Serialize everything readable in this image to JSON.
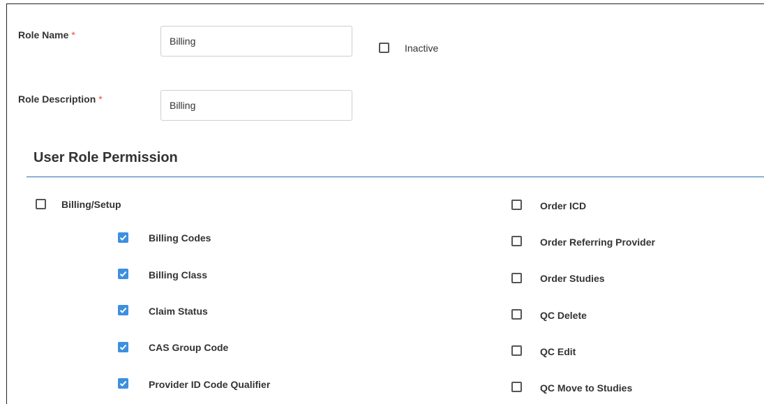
{
  "form": {
    "role_name_label": "Role Name",
    "role_name_value": "Billing",
    "role_description_label": "Role Description",
    "role_description_value": "Billing",
    "required_marker": "*",
    "inactive_label": "Inactive",
    "inactive_checked": false
  },
  "permissions": {
    "title": "User Role Permission",
    "group": {
      "label": "Billing/Setup",
      "checked": false,
      "children": [
        {
          "label": "Billing Codes",
          "checked": true
        },
        {
          "label": "Billing Class",
          "checked": true
        },
        {
          "label": "Claim Status",
          "checked": true
        },
        {
          "label": "CAS Group Code",
          "checked": true
        },
        {
          "label": "Provider ID Code Qualifier",
          "checked": true
        }
      ]
    },
    "right_column": [
      {
        "label": "Order ICD",
        "checked": false
      },
      {
        "label": "Order Referring Provider",
        "checked": false
      },
      {
        "label": "Order Studies",
        "checked": false
      },
      {
        "label": "QC Delete",
        "checked": false
      },
      {
        "label": "QC Edit",
        "checked": false
      },
      {
        "label": "QC Move to Studies",
        "checked": false
      }
    ]
  },
  "colors": {
    "checked_box": "#3d8fe0",
    "required_asterisk": "#e74c3c",
    "section_rule": "#2b6cb0"
  }
}
